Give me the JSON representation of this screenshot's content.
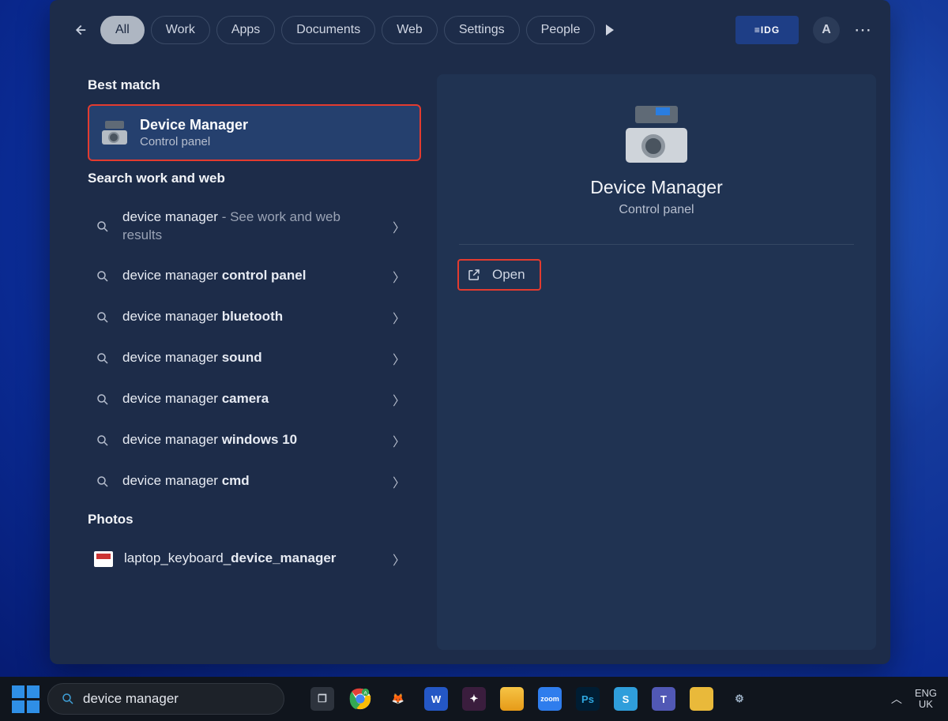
{
  "filters": {
    "all": "All",
    "work": "Work",
    "apps": "Apps",
    "documents": "Documents",
    "web": "Web",
    "settings": "Settings",
    "people": "People"
  },
  "header": {
    "org_label": "IDG",
    "avatar_initial": "A"
  },
  "sections": {
    "best_match": "Best match",
    "search_work_web": "Search work and web",
    "photos": "Photos"
  },
  "best_match": {
    "title": "Device Manager",
    "subtitle": "Control panel"
  },
  "suggestions": [
    {
      "prefix": "device manager",
      "bold": "",
      "hint": " - See work and web results"
    },
    {
      "prefix": "device manager ",
      "bold": "control panel",
      "hint": ""
    },
    {
      "prefix": "device manager ",
      "bold": "bluetooth",
      "hint": ""
    },
    {
      "prefix": "device manager ",
      "bold": "sound",
      "hint": ""
    },
    {
      "prefix": "device manager ",
      "bold": "camera",
      "hint": ""
    },
    {
      "prefix": "device manager ",
      "bold": "windows 10",
      "hint": ""
    },
    {
      "prefix": "device manager ",
      "bold": "cmd",
      "hint": ""
    }
  ],
  "photos": [
    {
      "prefix": "laptop_keyboard_",
      "bold": "device_manager"
    }
  ],
  "preview": {
    "title": "Device Manager",
    "subtitle": "Control panel",
    "open_label": "Open"
  },
  "taskbar": {
    "search_value": "device manager",
    "lang_top": "ENG",
    "lang_bottom": "UK"
  },
  "tb_apps": [
    {
      "name": "task-view-icon",
      "bg": "#2d333d",
      "fg": "#cfd4dd",
      "label": "❐"
    },
    {
      "name": "chrome-icon",
      "bg": "transparent",
      "fg": "",
      "label": "chrome"
    },
    {
      "name": "gimp-icon",
      "bg": "transparent",
      "fg": "#b08a55",
      "label": "🦊"
    },
    {
      "name": "word-icon",
      "bg": "#2457c5",
      "fg": "#fff",
      "label": "W"
    },
    {
      "name": "slack-icon",
      "bg": "#3a1d3d",
      "fg": "#fff",
      "label": "✦"
    },
    {
      "name": "file-explorer-icon",
      "bg": "#f6c445",
      "fg": "#5a3",
      "label": ""
    },
    {
      "name": "zoom-icon",
      "bg": "#2f7ded",
      "fg": "#fff",
      "label": "zoom"
    },
    {
      "name": "photoshop-icon",
      "bg": "#001d33",
      "fg": "#2fa8e0",
      "label": "Ps"
    },
    {
      "name": "snagit-icon",
      "bg": "#2f9edb",
      "fg": "#fff",
      "label": "S"
    },
    {
      "name": "teams-icon",
      "bg": "#5158b5",
      "fg": "#fff",
      "label": "T"
    },
    {
      "name": "sticky-notes-icon",
      "bg": "#e9b93a",
      "fg": "#333",
      "label": ""
    },
    {
      "name": "settings-icon",
      "bg": "transparent",
      "fg": "#9fb3c8",
      "label": "⚙"
    }
  ]
}
